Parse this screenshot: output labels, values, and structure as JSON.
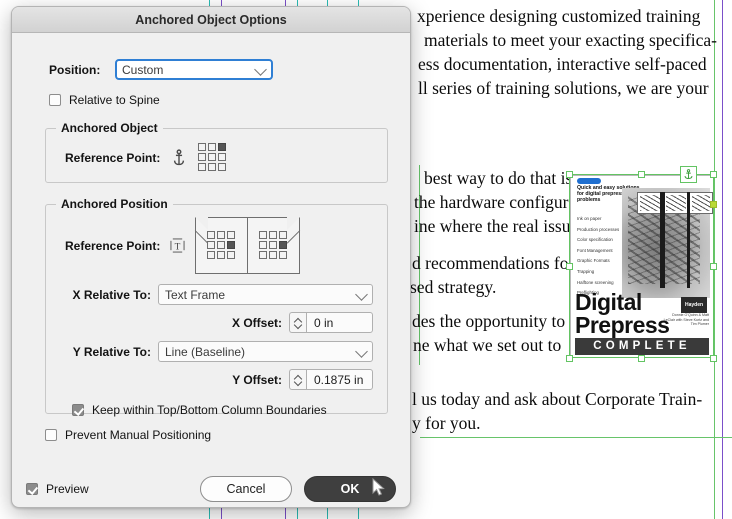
{
  "dialog": {
    "title": "Anchored Object Options",
    "position_label": "Position:",
    "position_value": "Custom",
    "relative_to_spine_label": "Relative to Spine",
    "relative_to_spine_checked": false,
    "anchored_object": {
      "legend": "Anchored Object",
      "reference_point_label": "Reference Point:",
      "anchor_icon": "anchor-icon",
      "selected_cell": "top-right"
    },
    "anchored_position": {
      "legend": "Anchored Position",
      "reference_point_label": "Reference Point:",
      "text_icon": "text-frame-icon",
      "selected_cell": "middle-right",
      "x_relative_to_label": "X Relative To:",
      "x_relative_to_value": "Text Frame",
      "x_offset_label": "X Offset:",
      "x_offset_value": "0 in",
      "y_relative_to_label": "Y Relative To:",
      "y_relative_to_value": "Line (Baseline)",
      "y_offset_label": "Y Offset:",
      "y_offset_value": "0.1875 in",
      "keep_within_label": "Keep within Top/Bottom Column Boundaries",
      "keep_within_checked": true
    },
    "prevent_manual_label": "Prevent Manual Positioning",
    "prevent_manual_checked": false,
    "preview_label": "Preview",
    "preview_checked": true,
    "cancel_label": "Cancel",
    "ok_label": "OK",
    "accent_focus_color": "#2f7fd4"
  },
  "document": {
    "paragraph_1": [
      "xperience designing customized training",
      "materials to meet your exacting specifica-",
      "ess documentation, interactive self-paced",
      "ll series of training solutions, we are your"
    ],
    "paragraph_2": [
      "best way to do that is",
      "the hardware configur",
      "ine where the real issu"
    ],
    "paragraph_3": [
      "d recommendations fo",
      "sed strategy."
    ],
    "paragraph_4": [
      "des the opportunity to",
      "ne what we set out to"
    ],
    "paragraph_5": [
      "l us today and ask about Corporate Train-",
      "y for you."
    ],
    "guide_colors": {
      "column": "#2bbdb6",
      "margin": "#7b4fc9",
      "frame": "#67c46a"
    }
  },
  "cover": {
    "headline": "Quick and easy solutions for digital prepress problems",
    "bullets": [
      "Ink on paper",
      "Production processes",
      "Color specification",
      "Font Management",
      "Graphic Formats",
      "Trapping",
      "Halftone screening",
      "Preflighting"
    ],
    "title": "Digital Prepress",
    "subtitle": "COMPLETE",
    "brand": "Hayden",
    "credit": "Donnie O'Quinn & Matt LeClair with Steve Kurtz and Tim Plumer"
  }
}
